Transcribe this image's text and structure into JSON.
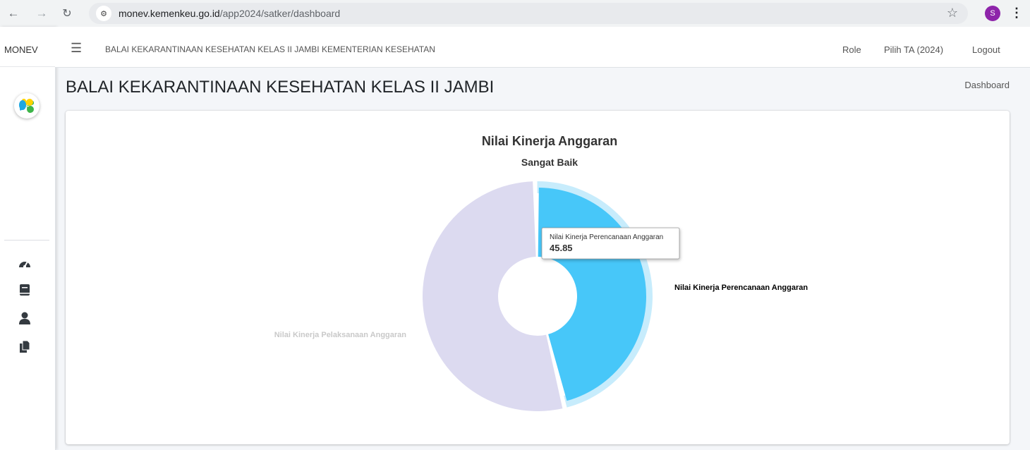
{
  "browser": {
    "url_host": "monev.kemenkeu.go.id",
    "url_path": "/app2024/satker/dashboard",
    "profile_initial": "S"
  },
  "sidebar": {
    "brand": "MONEV",
    "items": [
      {
        "icon": "tachometer-icon"
      },
      {
        "icon": "book-icon"
      },
      {
        "icon": "user-icon"
      },
      {
        "icon": "copy-icon"
      }
    ]
  },
  "navbar": {
    "org_name": "BALAI KEKARANTINAAN KESEHATAN KELAS II JAMBI KEMENTERIAN KESEHATAN",
    "role": "Role",
    "year": "Pilih TA (2024)",
    "logout": "Logout"
  },
  "page": {
    "title": "BALAI KEKARANTINAAN KESEHATAN KELAS II JAMBI",
    "breadcrumb": "Dashboard"
  },
  "colors": {
    "primary_slice": "#47c7f9",
    "primary_halo": "#c7ecfc",
    "secondary_slice": "#dcdaf0",
    "profile": "#8e24aa"
  },
  "chart_data": {
    "type": "pie",
    "title": "Nilai Kinerja Anggaran",
    "subtitle": "Sangat Baik",
    "series": [
      {
        "name": "Nilai Kinerja Perencanaan Anggaran",
        "value": 45.85
      },
      {
        "name": "Nilai Kinerja Pelaksanaan Anggaran",
        "value": 54.15
      }
    ],
    "tooltip": {
      "label": "Nilai Kinerja Perencanaan Anggaran",
      "value": "45.85"
    }
  }
}
